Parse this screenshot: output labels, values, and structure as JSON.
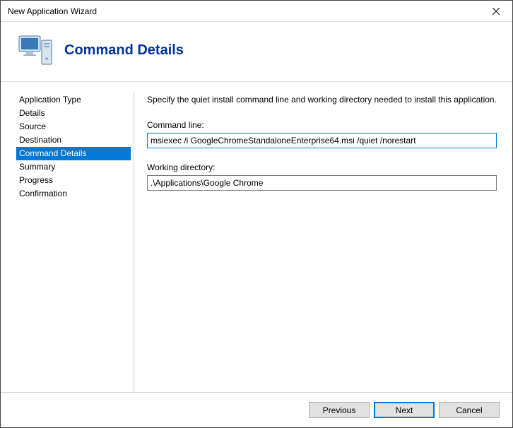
{
  "window": {
    "title": "New Application Wizard"
  },
  "header": {
    "title": "Command Details"
  },
  "sidebar": {
    "items": [
      {
        "label": "Application Type"
      },
      {
        "label": "Details"
      },
      {
        "label": "Source"
      },
      {
        "label": "Destination"
      },
      {
        "label": "Command Details"
      },
      {
        "label": "Summary"
      },
      {
        "label": "Progress"
      },
      {
        "label": "Confirmation"
      }
    ],
    "selected_index": 4
  },
  "main": {
    "instruction": "Specify the quiet install command line and working directory needed to install this application.",
    "command_line_label": "Command line:",
    "command_line_value": "msiexec /i GoogleChromeStandaloneEnterprise64.msi /quiet /norestart ",
    "working_dir_label": "Working directory:",
    "working_dir_value": ".\\Applications\\Google Chrome"
  },
  "footer": {
    "previous_label": "Previous",
    "next_label": "Next",
    "cancel_label": "Cancel"
  }
}
